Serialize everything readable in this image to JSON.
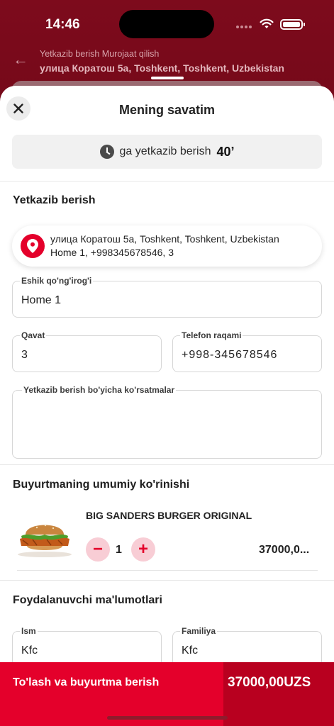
{
  "status_bar": {
    "time": "14:46"
  },
  "background": {
    "subtitle": "Yetkazib berish Murojaat qilish",
    "address": "улица Коратош 5а, Toshkent, Toshkent, Uzbekistan"
  },
  "sheet": {
    "title": "Mening savatim",
    "eta_label": "ga yetkazib berish",
    "eta_value": "40’"
  },
  "delivery": {
    "title": "Yetkazib berish",
    "address_line1": "улица Коратош 5а, Toshkent, Toshkent, Uzbekistan",
    "address_line2": "Home 1, +998345678546, 3",
    "entrance_label": "Eshik qo'ng'irog'i",
    "entrance_value": "Home 1",
    "floor_label": "Qavat",
    "floor_value": "3",
    "phone_label": "Telefon raqami",
    "phone_value": "+998-345678546",
    "instructions_label": "Yetkazib berish bo'yicha ko'rsatmalar",
    "instructions_value": ""
  },
  "order": {
    "title": "Buyurtmaning umumiy ko'rinishi",
    "items": [
      {
        "name": "BIG SANDERS BURGER ORIGINAL",
        "quantity": "1",
        "price": "37000,0..."
      }
    ],
    "minus_symbol": "−",
    "plus_symbol": "+"
  },
  "user": {
    "title": "Foydalanuvchi ma'lumotlari",
    "first_name_label": "Ism",
    "first_name_value": "Kfc",
    "last_name_label": "Familiya",
    "last_name_value": "Kfc"
  },
  "pay": {
    "label": "To'lash va buyurtma berish",
    "total": "37000,00UZS"
  },
  "colors": {
    "brand_red": "#e4002b",
    "dark_red": "#b8001f",
    "qty_button_bg": "#f8cdd5"
  }
}
